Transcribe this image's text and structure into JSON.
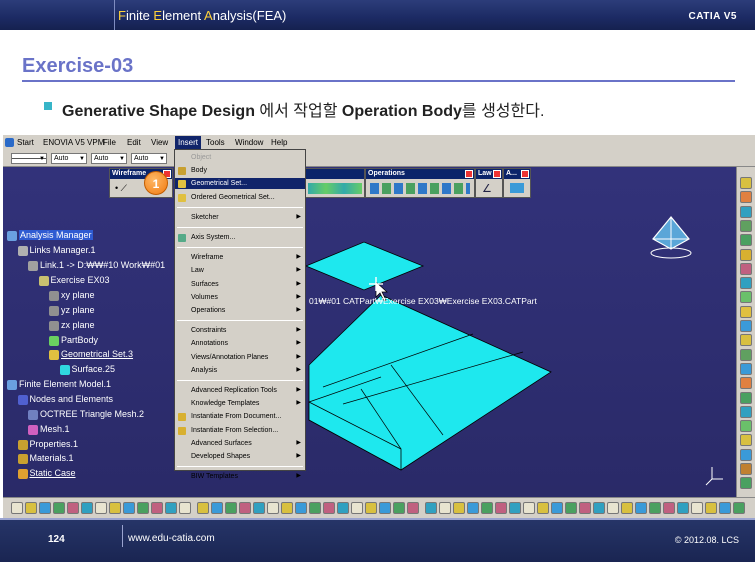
{
  "header": {
    "title_parts": [
      {
        "text": "F",
        "hl": true
      },
      {
        "text": "inite ",
        "hl": false
      },
      {
        "text": "E",
        "hl": true
      },
      {
        "text": "lement ",
        "hl": false
      },
      {
        "text": "A",
        "hl": true
      },
      {
        "text": "nalysis(FEA)",
        "hl": false
      }
    ],
    "brand": "CATIA V5"
  },
  "slide": {
    "title": "Exercise-03",
    "bullet_bold1": "Generative Shape Design",
    "bullet_normal": " 에서 작업할 ",
    "bullet_bold2": "Operation Body",
    "bullet_tail": "를 생성한다."
  },
  "app": {
    "menus": [
      "Start",
      "ENOVIA V5 VPM",
      "File",
      "Edit",
      "View",
      "Insert",
      "Tools",
      "Window",
      "Help"
    ],
    "combos": [
      "",
      "Auto",
      "Auto",
      "Auto"
    ],
    "toolbars": {
      "wireframe": "Wireframe",
      "operations": "Operations",
      "law": "Law",
      "a": "A..."
    },
    "callout": "1",
    "path_label": "01₩#01 CATPart₩Exercise EX03₩Exercise EX03.CATPart",
    "insert_menu": {
      "items": [
        {
          "label": "Object",
          "disabled": true,
          "arrow": false
        },
        {
          "label": "Body",
          "arrow": false,
          "icon": "#c8a030"
        },
        {
          "label": "Geometrical Set...",
          "highlight": true,
          "arrow": false,
          "icon": "#e0c040"
        },
        {
          "label": "Ordered Geometrical Set...",
          "arrow": false,
          "icon": "#e0c040"
        },
        {
          "sep": true
        },
        {
          "label": "Sketcher",
          "arrow": true
        },
        {
          "sep": true
        },
        {
          "label": "Axis System...",
          "arrow": false,
          "icon": "#5a8"
        },
        {
          "sep": true
        },
        {
          "label": "Wireframe",
          "arrow": true
        },
        {
          "label": "Law",
          "arrow": true
        },
        {
          "label": "Surfaces",
          "arrow": true
        },
        {
          "label": "Volumes",
          "arrow": true
        },
        {
          "label": "Operations",
          "arrow": true
        },
        {
          "sep": true
        },
        {
          "label": "Constraints",
          "arrow": true
        },
        {
          "label": "Annotations",
          "arrow": true
        },
        {
          "label": "Views/Annotation Planes",
          "arrow": true
        },
        {
          "label": "Analysis",
          "arrow": true
        },
        {
          "sep": true
        },
        {
          "label": "Advanced Replication Tools",
          "arrow": true
        },
        {
          "label": "Knowledge Templates",
          "arrow": true
        },
        {
          "label": "Instantiate From Document...",
          "arrow": false,
          "icon": "#d8b030"
        },
        {
          "label": "Instantiate From Selection...",
          "arrow": false,
          "icon": "#d8b030"
        },
        {
          "label": "Advanced Surfaces",
          "arrow": true
        },
        {
          "label": "Developed Shapes",
          "arrow": true
        },
        {
          "sep": true
        },
        {
          "label": "BIW Templates",
          "arrow": true
        }
      ]
    },
    "tree": [
      {
        "label": "Analysis Manager",
        "indent": 0,
        "selected": true,
        "icon": "#6aa0e0"
      },
      {
        "label": "Links Manager.1",
        "indent": 1,
        "icon": "#b0b0b0"
      },
      {
        "label": "Link.1 -> D:₩₩#10 Work₩#01",
        "indent": 2,
        "icon": "#a0a0a0"
      },
      {
        "label": "Exercise EX03",
        "indent": 3,
        "icon": "#c8c070"
      },
      {
        "label": "xy plane",
        "indent": 4,
        "icon": "#909090"
      },
      {
        "label": "yz plane",
        "indent": 4,
        "icon": "#909090"
      },
      {
        "label": "zx plane",
        "indent": 4,
        "icon": "#909090"
      },
      {
        "label": "PartBody",
        "indent": 4,
        "icon": "#6ad060"
      },
      {
        "label": "Geometrical Set.3",
        "indent": 4,
        "underline": true,
        "icon": "#e0c040"
      },
      {
        "label": "Surface.25",
        "indent": 5,
        "icon": "#30d8e0"
      },
      {
        "label": "Finite Element Model.1",
        "indent": 0,
        "icon": "#6aa0e0"
      },
      {
        "label": "Nodes and Elements",
        "indent": 1,
        "icon": "#5060d0"
      },
      {
        "label": "OCTREE Triangle Mesh.2",
        "indent": 2,
        "icon": "#7080c0"
      },
      {
        "label": "Mesh.1",
        "indent": 2,
        "icon": "#d060c0"
      },
      {
        "label": "Properties.1",
        "indent": 1,
        "icon": "#c8a030"
      },
      {
        "label": "Materials.1",
        "indent": 1,
        "icon": "#c8a030"
      },
      {
        "label": "Static Case",
        "indent": 1,
        "underline": true,
        "icon": "#e0a030"
      }
    ]
  },
  "footer": {
    "page": "124",
    "site": "www.edu-catia.com",
    "copyright": "© 2012.08. LCS"
  },
  "colors": {
    "title": "#6a73c8",
    "accent": "#ffd23a",
    "surface": "#1ee8ee",
    "viewport": "#2b2b6b"
  }
}
